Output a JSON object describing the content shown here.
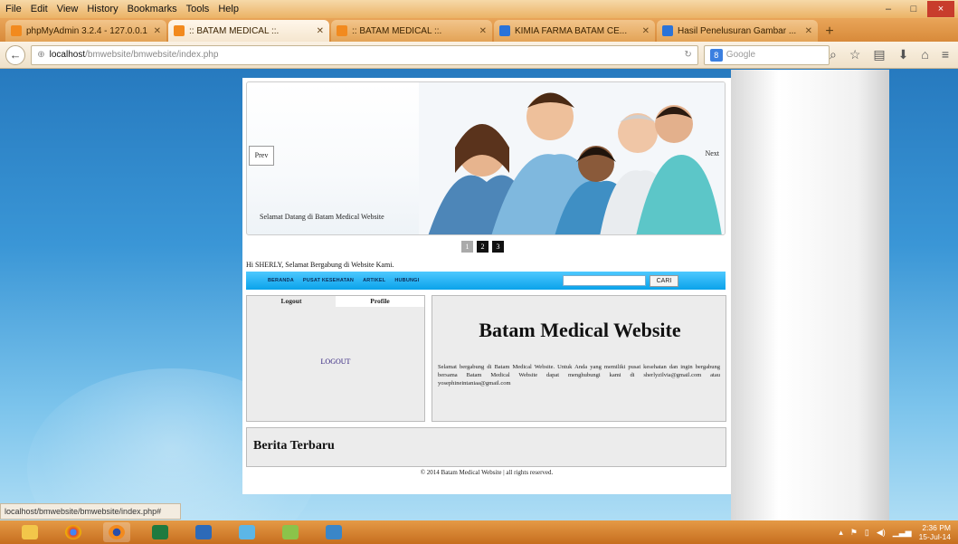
{
  "menubar": {
    "items": [
      "File",
      "Edit",
      "View",
      "History",
      "Bookmarks",
      "Tools",
      "Help"
    ]
  },
  "window_controls": {
    "minimize": "–",
    "maximize": "□",
    "close": "×"
  },
  "tabs": [
    {
      "label": "phpMyAdmin 3.2.4 - 127.0.0.1",
      "favicon": "orange"
    },
    {
      "label": ":: BATAM MEDICAL ::.",
      "favicon": "orange"
    },
    {
      "label": ":: BATAM MEDICAL ::.",
      "favicon": "orange"
    },
    {
      "label": "KIMIA FARMA BATAM CE...",
      "favicon": "blue"
    },
    {
      "label": "Hasil Penelusuran Gambar ...",
      "favicon": "blue"
    }
  ],
  "address": {
    "host": "localhost",
    "path": "/bmwebsite/bmwebsite/index.php",
    "search_placeholder": "Google"
  },
  "site": {
    "banner": {
      "prev": "Prev",
      "next": "Next",
      "caption": "Selamat Datang di Batam Medical Website"
    },
    "pager": [
      "1",
      "2",
      "3"
    ],
    "greeting": "Hi SHERLY, Selamat Bergabung di Website Kami.",
    "menu": [
      "BERANDA",
      "PUSAT KESEHATAN",
      "ARTIKEL",
      "HUBUNGI"
    ],
    "search_button": "CARI",
    "side_tabs": [
      "Logout",
      "Profile"
    ],
    "logout_link": "LOGOUT",
    "title": "Batam Medical Website",
    "welcome": "Selamat bergabung di Batam Medical Website. Untuk Anda yang memiliki pusat kesehatan dan ingin bergabung bersama Batam Medical Website dapat menghubungi kami di sherlyzilvia@gmail.com atau yosephineintaniaa@gmail.com",
    "news_title": "Berita Terbaru",
    "footer": "© 2014 Batam Medical Website | all rights reserved."
  },
  "status": "localhost/bmwebsite/bmwebsite/index.php#",
  "clock": {
    "time": "2:36 PM",
    "date": "15-Jul-14"
  }
}
